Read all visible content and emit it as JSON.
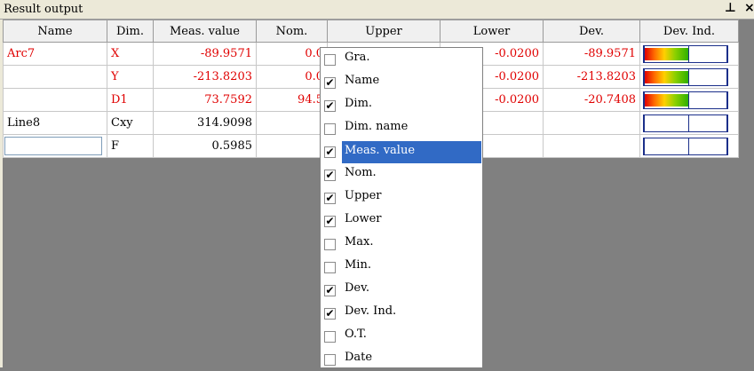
{
  "panel": {
    "title": "Result output",
    "pin_icon": "pin-icon",
    "close_icon": "close-icon"
  },
  "columns": [
    "Name",
    "Dim.",
    "Meas. value",
    "Nom.",
    "Upper",
    "Lower",
    "Dev.",
    "Dev. Ind."
  ],
  "rows": [
    {
      "color": "#e00000",
      "name": "Arc7",
      "dim": "X",
      "meas": "-89.9571",
      "nom": "0.0",
      "lower": "-0.0200",
      "dev": "-89.9571",
      "devind_level": 0.53
    },
    {
      "color": "#e00000",
      "name": "",
      "dim": "Y",
      "meas": "-213.8203",
      "nom": "0.0",
      "lower": "-0.0200",
      "dev": "-213.8203",
      "devind_level": 0.53
    },
    {
      "color": "#e00000",
      "name": "",
      "dim": "D1",
      "meas": "73.7592",
      "nom": "94.5",
      "lower": "-0.0200",
      "dev": "-20.7408",
      "devind_level": 0.53
    },
    {
      "color": "#000000",
      "name": "Line8",
      "dim": "Cxy",
      "meas": "314.9098",
      "nom": "",
      "lower": "",
      "dev": "",
      "devind_level": 0
    },
    {
      "color": "#000000",
      "name": "",
      "dim": "F",
      "meas": "0.5985",
      "nom": "",
      "lower": "",
      "dev": "",
      "devind_level": 0
    }
  ],
  "column_menu": {
    "selected_color": "#316ac5",
    "items": [
      {
        "label": "Gra.",
        "checked": false
      },
      {
        "label": "Name",
        "checked": true
      },
      {
        "label": "Dim.",
        "checked": true
      },
      {
        "label": "Dim. name",
        "checked": false
      },
      {
        "label": "Meas. value",
        "checked": true,
        "selected": true
      },
      {
        "label": "Nom.",
        "checked": true
      },
      {
        "label": "Upper",
        "checked": true
      },
      {
        "label": "Lower",
        "checked": true
      },
      {
        "label": "Max.",
        "checked": false
      },
      {
        "label": "Min.",
        "checked": false
      },
      {
        "label": "Dev.",
        "checked": true
      },
      {
        "label": "Dev. Ind.",
        "checked": true
      },
      {
        "label": "O.T.",
        "checked": false
      },
      {
        "label": "Date",
        "checked": false
      }
    ]
  }
}
